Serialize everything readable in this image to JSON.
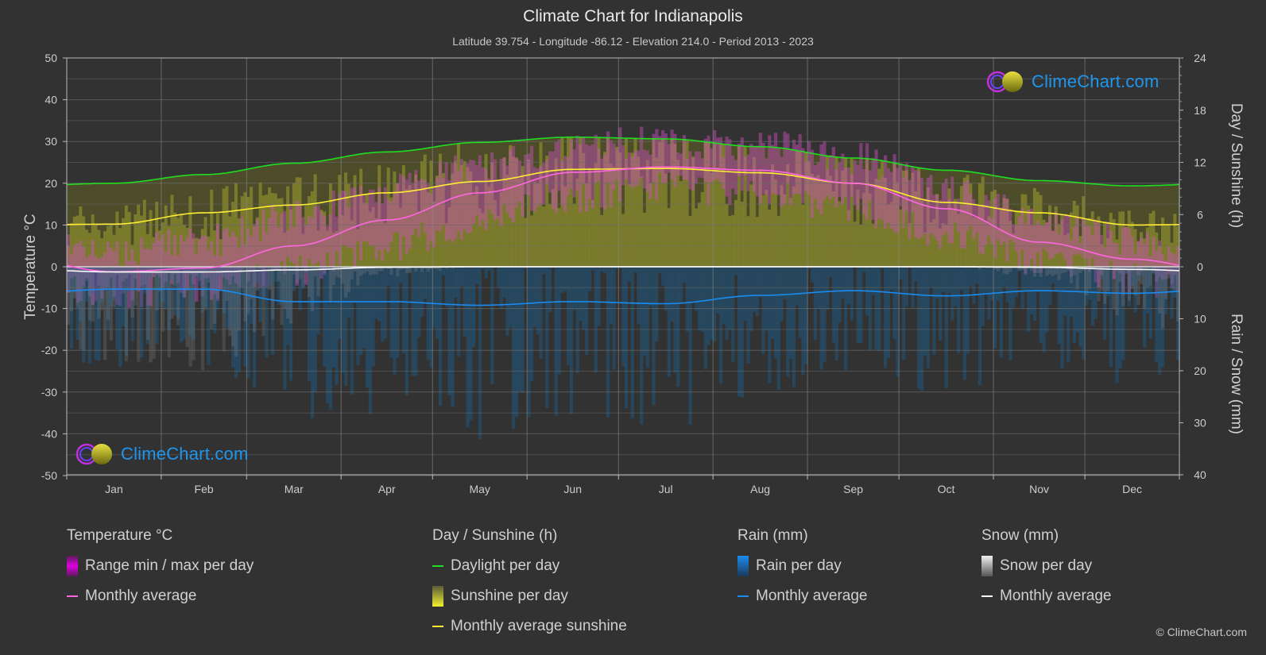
{
  "header": {
    "title": "Climate Chart for Indianapolis",
    "subtitle": "Latitude 39.754 - Longitude -86.12 - Elevation 214.0 - Period 2013 - 2023"
  },
  "logo_text": "ClimeChart.com",
  "copyright": "© ClimeChart.com",
  "colors": {
    "background": "#323232",
    "grid": "#5a5a5a",
    "temperature_avg": "#ff66e0",
    "temperature_range": "#e000e0",
    "daylight": "#22dd22",
    "sunshine_avg": "#ffee33",
    "sunshine_bar": "#9a9a30",
    "rain_avg": "#1a8cf0",
    "rain_bar": "#1d5f8f",
    "snow_avg": "#ffffff",
    "snow_bar": "#8a8a8a",
    "logo_text": "#1f96ee"
  },
  "legend": {
    "groups": [
      {
        "title": "Temperature °C",
        "items": [
          {
            "label": "Range min / max per day",
            "kind": "bar",
            "swatch": "temp-range"
          },
          {
            "label": "Monthly average",
            "kind": "line",
            "swatch": "temp-avg"
          }
        ]
      },
      {
        "title": "Day / Sunshine (h)",
        "items": [
          {
            "label": "Daylight per day",
            "kind": "line",
            "swatch": "daylight"
          },
          {
            "label": "Sunshine per day",
            "kind": "bar",
            "swatch": "sunshine-bar"
          },
          {
            "label": "Monthly average sunshine",
            "kind": "line",
            "swatch": "sunshine-avg"
          }
        ]
      },
      {
        "title": "Rain (mm)",
        "items": [
          {
            "label": "Rain per day",
            "kind": "bar",
            "swatch": "rain-bar"
          },
          {
            "label": "Monthly average",
            "kind": "line",
            "swatch": "rain-avg"
          }
        ]
      },
      {
        "title": "Snow (mm)",
        "items": [
          {
            "label": "Snow per day",
            "kind": "bar",
            "swatch": "snow-bar"
          },
          {
            "label": "Monthly average",
            "kind": "line",
            "swatch": "snow-avg"
          }
        ]
      }
    ]
  },
  "chart_data": {
    "type": "line",
    "title": "Climate Chart for Indianapolis",
    "subtitle": "Latitude 39.754 - Longitude -86.12 - Elevation 214.0 - Period 2013 - 2023",
    "categories": [
      "Jan",
      "Feb",
      "Mar",
      "Apr",
      "May",
      "Jun",
      "Jul",
      "Aug",
      "Sep",
      "Oct",
      "Nov",
      "Dec"
    ],
    "axes": {
      "left": {
        "label": "Temperature °C",
        "range": [
          -50,
          50
        ],
        "ticks": [
          50,
          40,
          30,
          20,
          10,
          0,
          -10,
          -20,
          -30,
          -40,
          -50
        ]
      },
      "right_top": {
        "label": "Day / Sunshine (h)",
        "range": [
          0,
          24
        ],
        "ticks": [
          24,
          18,
          12,
          6,
          0
        ]
      },
      "right_bottom": {
        "label": "Rain / Snow (mm)",
        "range": [
          0,
          40
        ],
        "ticks": [
          0,
          10,
          20,
          30,
          40
        ]
      }
    },
    "grid": true,
    "series": [
      {
        "name": "Temperature monthly average",
        "axis": "left",
        "unit": "°C",
        "values": [
          -1.2,
          -0.3,
          5.0,
          11.2,
          17.7,
          22.6,
          23.9,
          23.1,
          20.0,
          13.9,
          5.9,
          1.8
        ]
      },
      {
        "name": "Temperature daily max (approx. envelope)",
        "axis": "left",
        "unit": "°C",
        "values": [
          3,
          6,
          12,
          18,
          24,
          29,
          30,
          29,
          26,
          19,
          11,
          6
        ]
      },
      {
        "name": "Temperature daily min (approx. envelope)",
        "axis": "left",
        "unit": "°C",
        "values": [
          -6,
          -5,
          -1,
          5,
          11,
          17,
          19,
          18,
          14,
          8,
          1,
          -3
        ]
      },
      {
        "name": "Daylight per day",
        "axis": "right_top",
        "unit": "h",
        "values": [
          9.6,
          10.6,
          11.9,
          13.2,
          14.3,
          14.9,
          14.7,
          13.8,
          12.5,
          11.1,
          9.9,
          9.3
        ]
      },
      {
        "name": "Monthly average sunshine",
        "axis": "right_top",
        "unit": "h",
        "values": [
          4.9,
          6.2,
          7.1,
          8.5,
          9.8,
          11.2,
          11.3,
          10.8,
          9.6,
          7.4,
          6.2,
          4.8
        ]
      },
      {
        "name": "Rain monthly average",
        "axis": "right_bottom",
        "unit": "mm",
        "values": [
          4.3,
          4.3,
          6.7,
          6.7,
          7.4,
          6.7,
          7.1,
          5.5,
          4.6,
          5.6,
          4.6,
          5.1
        ]
      },
      {
        "name": "Snow monthly average",
        "axis": "right_bottom",
        "unit": "mm",
        "values": [
          1.0,
          1.0,
          0.6,
          0.1,
          0.0,
          0.0,
          0.0,
          0.0,
          0.0,
          0.0,
          0.1,
          0.5
        ]
      }
    ],
    "legend_position": "bottom"
  }
}
